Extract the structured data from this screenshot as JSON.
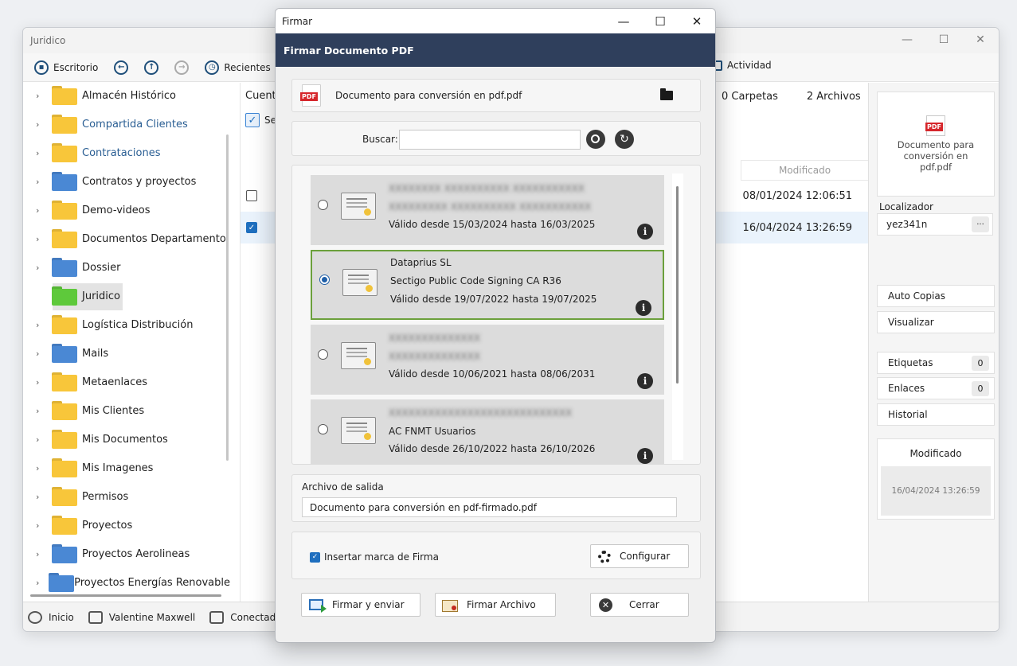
{
  "main_window": {
    "title": "Juridico",
    "toolbar": {
      "escritorio": "Escritorio",
      "recientes": "Recientes",
      "actividad": "Actividad"
    },
    "tree": [
      {
        "label": "Almacén Histórico",
        "color": "yellow"
      },
      {
        "label": "Compartida Clientes",
        "color": "yellow",
        "link": true
      },
      {
        "label": "Contrataciones",
        "color": "yellow",
        "link": true
      },
      {
        "label": "Contratos y proyectos",
        "color": "blue"
      },
      {
        "label": "Demo-videos",
        "color": "yellow"
      },
      {
        "label": "Documentos Departamento",
        "color": "yellow"
      },
      {
        "label": "Dossier",
        "color": "blue"
      },
      {
        "label": "Juridico",
        "color": "green",
        "selected": true
      },
      {
        "label": "Logística Distribución",
        "color": "yellow"
      },
      {
        "label": "Mails",
        "color": "blue"
      },
      {
        "label": "Metaenlaces",
        "color": "yellow"
      },
      {
        "label": "Mis Clientes",
        "color": "yellow"
      },
      {
        "label": "Mis Documentos",
        "color": "yellow"
      },
      {
        "label": "Mis Imagenes",
        "color": "yellow"
      },
      {
        "label": "Permisos",
        "color": "yellow"
      },
      {
        "label": "Proyectos",
        "color": "yellow"
      },
      {
        "label": "Proyectos Aerolineas",
        "color": "blue"
      },
      {
        "label": "Proyectos Energías Renovable",
        "color": "blue"
      }
    ],
    "list": {
      "header_left": "Cuenta",
      "select_label": "Sel",
      "carpetas": "0 Carpetas",
      "archivos": "2 Archivos",
      "col_modificado": "Modificado",
      "rows": [
        {
          "date": "08/01/2024 12:06:51",
          "checked": false
        },
        {
          "date": "16/04/2024 13:26:59",
          "checked": true
        }
      ]
    },
    "right_panel": {
      "preview_name": "Documento para conversión en pdf.pdf",
      "pdf_tag": "PDF",
      "localizador_label": "Localizador",
      "localizador_value": "yez341n",
      "dots": "...",
      "auto_copias": "Auto Copias",
      "visualizar": "Visualizar",
      "etiquetas": "Etiquetas",
      "etiquetas_count": "0",
      "enlaces": "Enlaces",
      "enlaces_count": "0",
      "historial": "Historial",
      "modificado_title": "Modificado",
      "modificado_date": "16/04/2024 13:26:59"
    },
    "statusbar": {
      "inicio": "Inicio",
      "user": "Valentine Maxwell",
      "conectados": "Conectados"
    }
  },
  "dialog": {
    "title": "Firmar",
    "banner": "Firmar Documento PDF",
    "pdf_tag": "PDF",
    "document_name": "Documento para conversión en pdf.pdf",
    "search_label": "Buscar:",
    "search_value": "",
    "certificates": [
      {
        "line1": "XXXXXXXX XXXXXXXXXX XXXXXXXXXXX",
        "line2": "XXXXXXXXX XXXXXXXXXX XXXXXXXXXXX",
        "validity": "Válido desde 15/03/2024 hasta 16/03/2025",
        "blurred": true,
        "selected": false
      },
      {
        "line1": "Dataprius SL",
        "line2": "Sectigo Public Code Signing CA R36",
        "validity": "Válido desde 19/07/2022 hasta 19/07/2025",
        "blurred": false,
        "selected": true
      },
      {
        "line1": "XXXXXXXXXXXXXX",
        "line2": "XXXXXXXXXXXXXX",
        "validity": "Válido desde 10/06/2021 hasta 08/06/2031",
        "blurred": true,
        "selected": false
      },
      {
        "line1": "XXXXXXXXXXXXXXXXXXXXXXXXXXXX",
        "line2": "AC FNMT Usuarios",
        "validity": "Válido desde 26/10/2022 hasta 26/10/2026",
        "blurred": true,
        "selected": false
      }
    ],
    "output_label": "Archivo de salida",
    "output_value": "Documento para conversión en pdf-firmado.pdf",
    "insert_mark_label": "Insertar marca de Firma",
    "configurar": "Configurar",
    "firmar_enviar": "Firmar y enviar",
    "firmar_archivo": "Firmar Archivo",
    "cerrar": "Cerrar"
  }
}
